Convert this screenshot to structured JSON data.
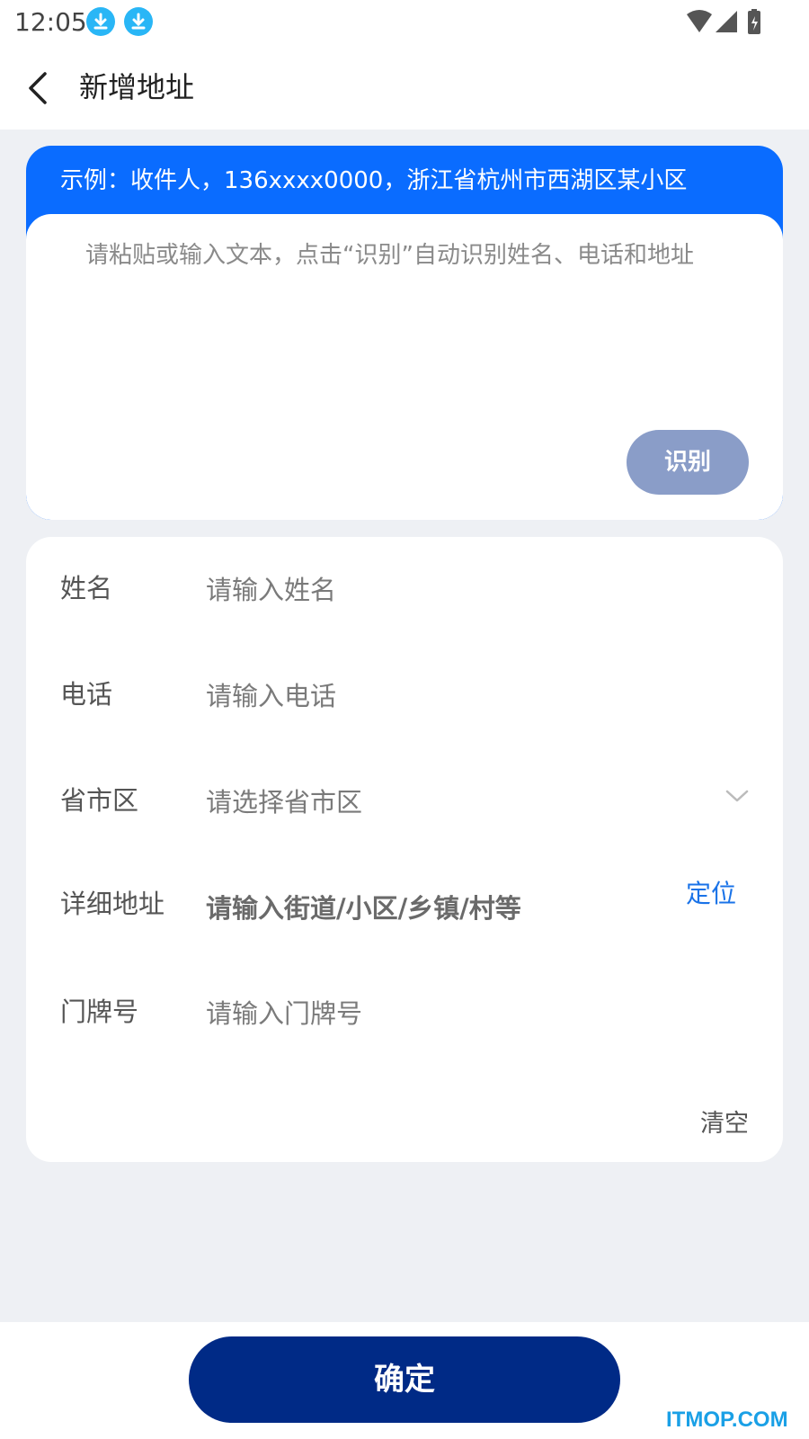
{
  "status_bar": {
    "time": "12:05",
    "icons": [
      "download-icon",
      "download-icon",
      "wifi-icon",
      "signal-icon",
      "battery-icon"
    ]
  },
  "header": {
    "back_icon": "back-arrow-icon",
    "title": "新增地址"
  },
  "smart_paste": {
    "example": "示例：收件人，136xxxx0000，浙江省杭州市西湖区某小区",
    "placeholder": "请粘贴或输入文本，点击“识别”自动识别姓名、电话和地址",
    "recognize_label": "识别"
  },
  "form": {
    "name": {
      "label": "姓名",
      "placeholder": "请输入姓名"
    },
    "phone": {
      "label": "电话",
      "placeholder": "请输入电话"
    },
    "region": {
      "label": "省市区",
      "placeholder": "请选择省市区",
      "icon": "chevron-down-icon"
    },
    "detail": {
      "label": "详细地址",
      "placeholder": "请输入街道/小区/乡镇/村等",
      "locate_label": "定位"
    },
    "door": {
      "label": "门牌号",
      "placeholder": "请输入门牌号"
    },
    "clear_label": "清空"
  },
  "footer": {
    "confirm_label": "确定"
  },
  "watermark": "ITMOP.COM",
  "colors": {
    "accent_blue": "#0a6cff",
    "confirm_button": "#002a86",
    "recognize_button": "#8a9dc8",
    "link_blue": "#1a73e8",
    "background": "#eef0f4"
  }
}
